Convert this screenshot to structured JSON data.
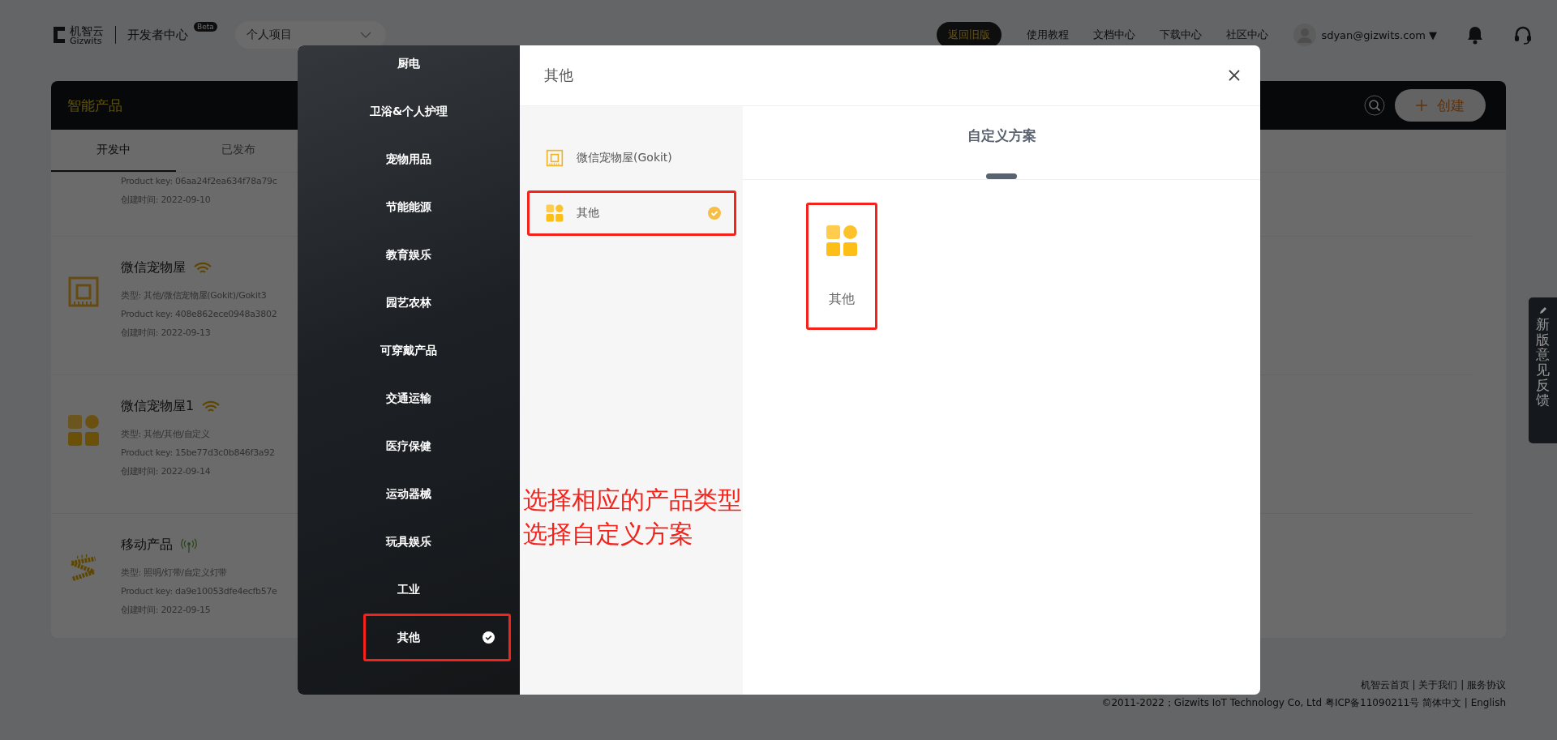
{
  "header": {
    "logo_name": "机智云",
    "logo_sub": "Gizwits",
    "portal": "开发者中心",
    "badge": "Beta",
    "project_select": {
      "value": "个人项目"
    },
    "nav": [
      {
        "label": "返回旧版",
        "kind": "button"
      },
      {
        "label": "使用教程",
        "kind": "link"
      },
      {
        "label": "文档中心",
        "kind": "link"
      },
      {
        "label": "下载中心",
        "kind": "link"
      },
      {
        "label": "社区中心",
        "kind": "link"
      }
    ],
    "user": "sdyan@gizwits.com",
    "caret": "▼"
  },
  "panel": {
    "title": "智能产品",
    "create_button": "创建",
    "tabs": [
      {
        "label": "开发中",
        "selected": true
      },
      {
        "label": "已发布",
        "selected": false
      }
    ],
    "products": [
      {
        "kind": "partial",
        "lines": [
          "Product key: 06aa24f2ea634f78a79c",
          "创建时间: 2022-09-10"
        ]
      },
      {
        "title": "微信宠物屋",
        "kind": "chip",
        "signal": {
          "kind": "wifi"
        },
        "lines": [
          "类型: 其他/微信宠物屋(Gokit)/Gokit3",
          "Product key: 408e862ece0948a3802",
          "创建时间: 2022-09-13"
        ]
      },
      {
        "title": "微信宠物屋1",
        "kind": "grid",
        "signal": {
          "kind": "wifi"
        },
        "lines": [
          "类型: 其他/其他/自定义",
          "Product key: 15be77d3c0b846f3a92",
          "创建时间: 2022-09-14"
        ]
      },
      {
        "title": "移动产品",
        "kind": "strip",
        "signal": {
          "kind": "cellular"
        },
        "lines": [
          "类型: 照明/灯带/自定义灯带",
          "Product key: da9e10053dfe4ecfb57e",
          "创建时间: 2022-09-15"
        ]
      }
    ]
  },
  "footer": {
    "links": "机智云首页 | 关于我们 | 服务协议",
    "copyright": "©2011-2022；Gizwits IoT Technology Co, Ltd 粤ICP备11090211号 简体中文 | English"
  },
  "feedback_tab": {
    "label": "新版意见反馈"
  },
  "modal": {
    "title": "其他",
    "categories": [
      {
        "label": "厨电",
        "selected": false,
        "highlighted": false
      },
      {
        "label": "卫浴&个人护理",
        "selected": false,
        "highlighted": false
      },
      {
        "label": "宠物用品",
        "selected": false,
        "highlighted": false
      },
      {
        "label": "节能能源",
        "selected": false,
        "highlighted": false
      },
      {
        "label": "教育娱乐",
        "selected": false,
        "highlighted": false
      },
      {
        "label": "园艺农林",
        "selected": false,
        "highlighted": false
      },
      {
        "label": "可穿戴产品",
        "selected": false,
        "highlighted": false
      },
      {
        "label": "交通运输",
        "selected": false,
        "highlighted": false
      },
      {
        "label": "医疗保健",
        "selected": false,
        "highlighted": false
      },
      {
        "label": "运动器械",
        "selected": false,
        "highlighted": false
      },
      {
        "label": "玩具娱乐",
        "selected": false,
        "highlighted": false
      },
      {
        "label": "工业",
        "selected": false,
        "highlighted": false
      },
      {
        "label": "其他",
        "selected": true,
        "highlighted": true
      }
    ],
    "solutions": [
      {
        "label": "微信宠物屋(Gokit)",
        "kind": "chip",
        "selected": false,
        "highlighted": false
      },
      {
        "label": "其他",
        "kind": "grid",
        "selected": true,
        "highlighted": true
      }
    ],
    "scheme_tabs": [
      {
        "label": "自定义方案",
        "selected": true
      }
    ],
    "schemes": [
      {
        "label": "其他",
        "kind": "grid",
        "highlighted": true
      }
    ]
  },
  "annotation": {
    "lines": [
      "选择相应的产品类型",
      "选择自定义方案"
    ]
  }
}
